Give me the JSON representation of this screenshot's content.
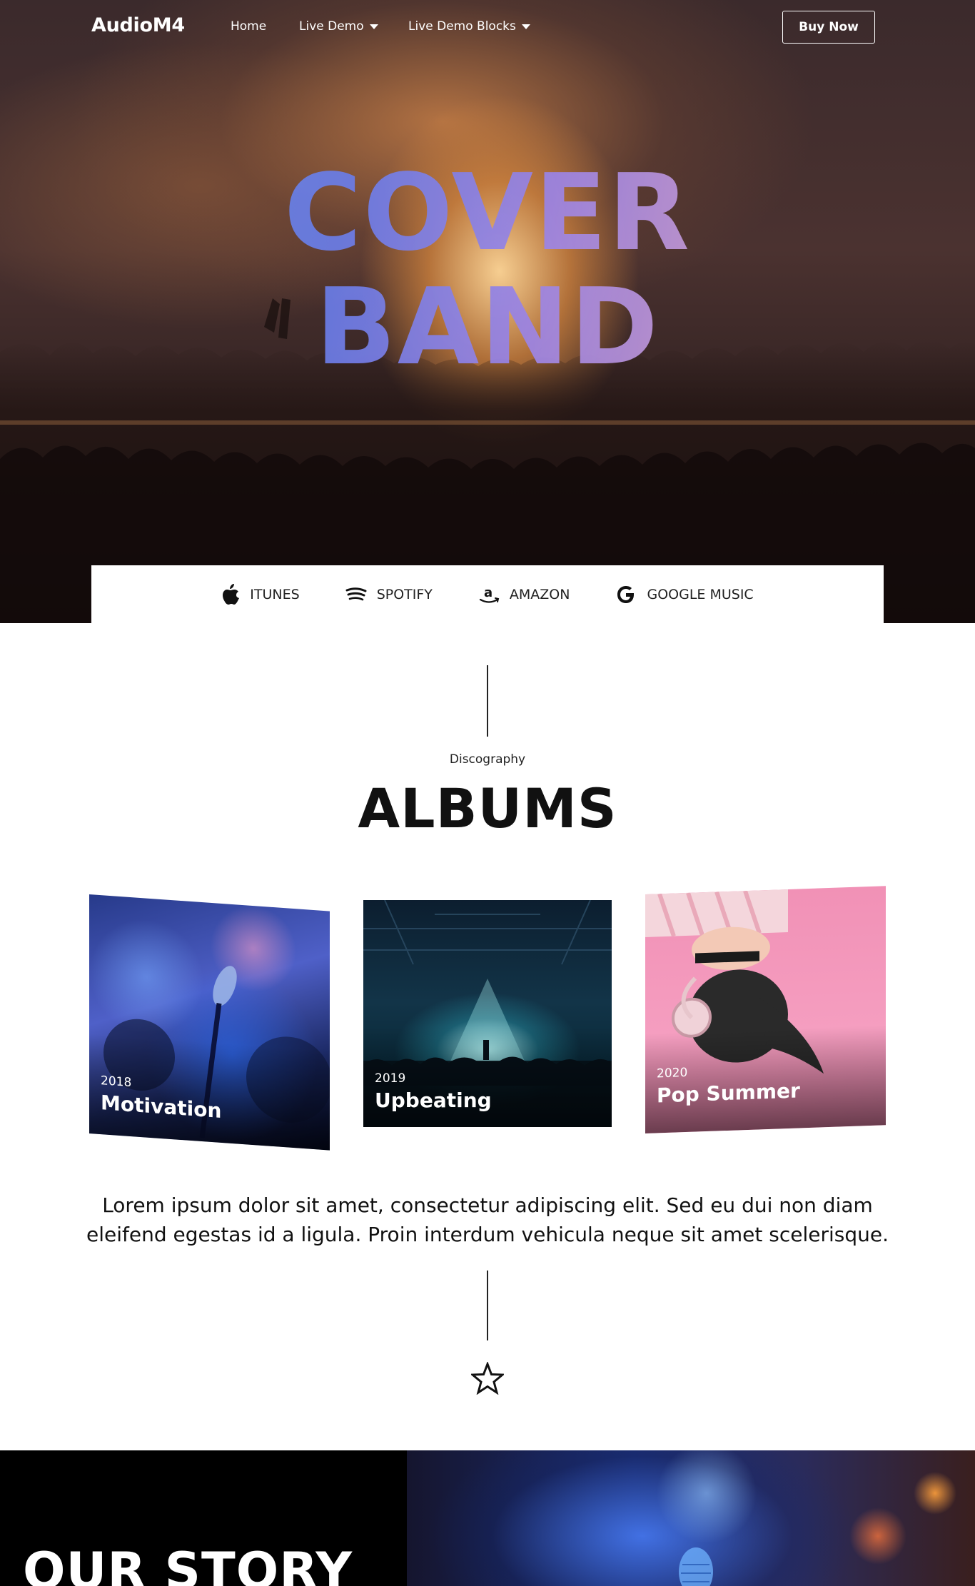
{
  "header": {
    "logo": "AudioM4",
    "nav": [
      {
        "label": "Home",
        "has_dropdown": false
      },
      {
        "label": "Live Demo",
        "has_dropdown": true
      },
      {
        "label": "Live Demo Blocks",
        "has_dropdown": true
      }
    ],
    "cta_label": "Buy Now"
  },
  "hero": {
    "title_line1": "COVER",
    "title_line2": "BAND"
  },
  "streaming": [
    {
      "icon": "apple-icon",
      "label": "ITUNES"
    },
    {
      "icon": "spotify-icon",
      "label": "SPOTIFY"
    },
    {
      "icon": "amazon-icon",
      "label": "AMAZON"
    },
    {
      "icon": "google-icon",
      "label": "GOOGLE MUSIC"
    }
  ],
  "discography": {
    "kicker": "Discography",
    "title": "ALBUMS",
    "albums": [
      {
        "year": "2018",
        "name": "Motivation"
      },
      {
        "year": "2019",
        "name": "Upbeating"
      },
      {
        "year": "2020",
        "name": "Pop Summer"
      }
    ],
    "description": "Lorem ipsum dolor sit amet, consectetur adipiscing elit. Sed eu dui non diam eleifend egestas id a ligula. Proin interdum vehicula neque sit amet scelerisque."
  },
  "story": {
    "title": "OUR STORY"
  },
  "colors": {
    "title_gradient_start": "#5a8ff0",
    "title_gradient_end": "#efb8c8",
    "story_bg": "#000000"
  }
}
